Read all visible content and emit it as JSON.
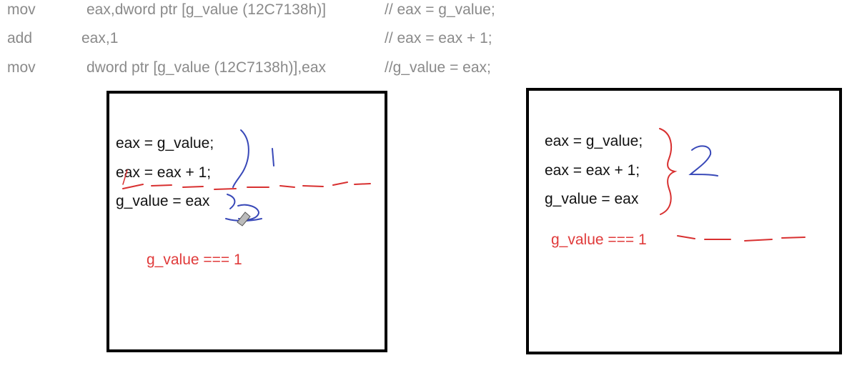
{
  "assembly": [
    {
      "op": "mov",
      "operands": "eax,dword ptr [g_value (12C7138h)]",
      "comment": "// eax = g_value;"
    },
    {
      "op": "add",
      "operands": "eax,1",
      "comment": "// eax = eax + 1;"
    },
    {
      "op": "mov",
      "operands": "dword ptr [g_value (12C7138h)],eax",
      "comment": "//g_value = eax;"
    }
  ],
  "left_panel": {
    "statements": [
      "eax = g_value;",
      "eax = eax + 1;",
      "g_value = eax"
    ],
    "result": "g_value === 1"
  },
  "right_panel": {
    "statements": [
      "eax = g_value;",
      "eax = eax + 1;",
      "g_value = eax"
    ],
    "result": "g_value === 1"
  },
  "colors": {
    "code_gray": "#8a8a8a",
    "statement_black": "#111111",
    "result_red": "#e03a3a",
    "annotation_blue": "#3848b8",
    "annotation_red": "#d83030"
  }
}
